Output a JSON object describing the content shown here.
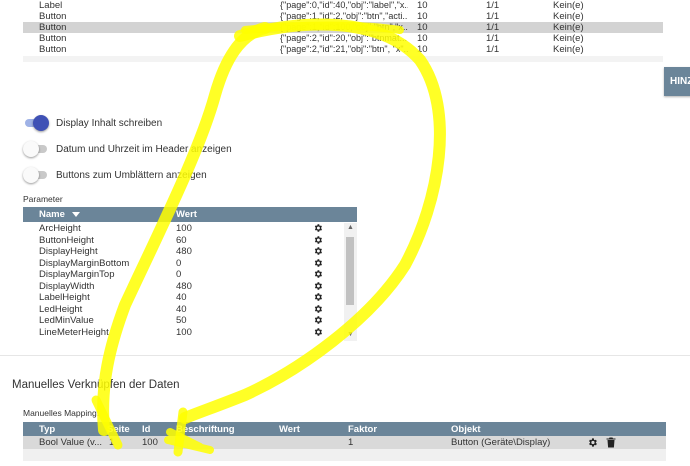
{
  "top_table": {
    "rows": [
      {
        "type": "Label",
        "obj": "{\"page\":0,\"id\":40,\"obj\":\"label\",\"x...",
        "n1": "10",
        "n2": "1/1",
        "k": "Kein(e)",
        "selected": false
      },
      {
        "type": "Button",
        "obj": "{\"page\":1,\"id\":2,\"obj\":\"btn\",\"acti...",
        "n1": "10",
        "n2": "1/1",
        "k": "Kein(e)",
        "selected": false
      },
      {
        "type": "Button",
        "obj": "{\"page\":1,\"id\":100,\"obj\":\"btn\",\"x...",
        "n1": "10",
        "n2": "1/1",
        "k": "Kein(e)",
        "selected": true
      },
      {
        "type": "Button",
        "obj": "{\"page\":2,\"id\":20,\"obj\":\"btnmat...",
        "n1": "10",
        "n2": "1/1",
        "k": "Kein(e)",
        "selected": false
      },
      {
        "type": "Button",
        "obj": "{\"page\":2,\"id\":21,\"obj\":\"btn\", \"x\"...",
        "n1": "10",
        "n2": "1/1",
        "k": "Kein(e)",
        "selected": false
      }
    ]
  },
  "add_button_label": "HINZ",
  "toggles": [
    {
      "label": "Display Inhalt schreiben",
      "on": true
    },
    {
      "label": "Datum und Uhrzeit im Header anzeigen",
      "on": false
    },
    {
      "label": "Buttons zum Umblättern anzeigen",
      "on": false
    }
  ],
  "parameters": {
    "section_label": "Parameter",
    "col_name": "Name",
    "col_value": "Wert",
    "sort_icon": "sort-down-icon",
    "rows": [
      {
        "name": "ArcHeight",
        "value": "100"
      },
      {
        "name": "ButtonHeight",
        "value": "60"
      },
      {
        "name": "DisplayHeight",
        "value": "480"
      },
      {
        "name": "DisplayMarginBottom",
        "value": "0"
      },
      {
        "name": "DisplayMarginTop",
        "value": "0"
      },
      {
        "name": "DisplayWidth",
        "value": "480"
      },
      {
        "name": "LabelHeight",
        "value": "40"
      },
      {
        "name": "LedHeight",
        "value": "40"
      },
      {
        "name": "LedMinValue",
        "value": "50"
      },
      {
        "name": "LineMeterHeight",
        "value": "100"
      }
    ]
  },
  "mapping": {
    "title": "Manuelles Verknüpfen der Daten",
    "section_label": "Manuelles Mapping:",
    "columns": {
      "typ": "Typ",
      "seite": "Seite",
      "id": "Id",
      "beschriftung": "Beschriftung",
      "wert": "Wert",
      "faktor": "Faktor",
      "objekt": "Objekt"
    },
    "row": {
      "typ": "Bool Value (v...",
      "seite": "1",
      "id": "100",
      "beschriftung": "",
      "wert": "",
      "faktor": "1",
      "objekt": "Button (Geräte\\Display)"
    }
  },
  "colors": {
    "header_bg": "#6b8599",
    "accent": "#3f51b5",
    "highlight": "#ffff00"
  }
}
